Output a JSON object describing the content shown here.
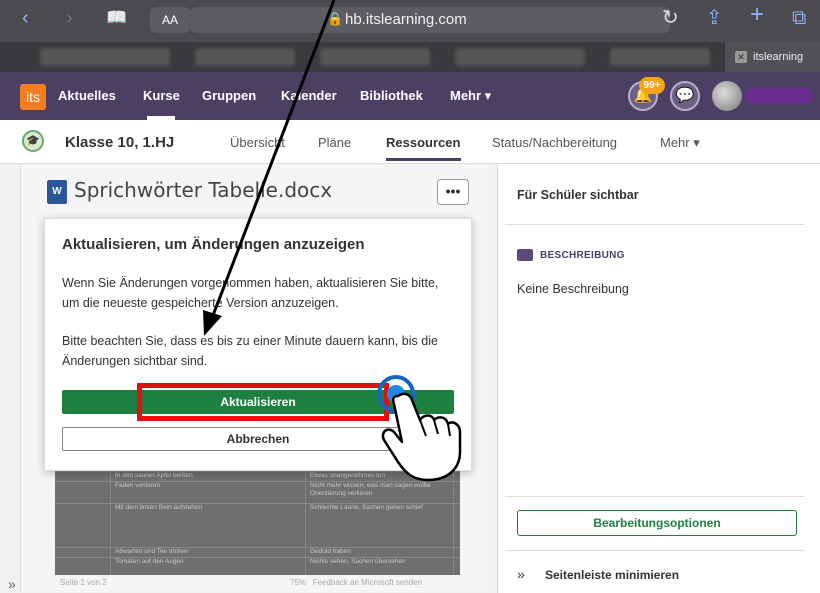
{
  "browser": {
    "aa_label": "AA",
    "url": "hb.itslearning.com",
    "tab_label": "itslearning"
  },
  "appbar": {
    "logo": "its",
    "nav": [
      "Aktuelles",
      "Kurse",
      "Gruppen",
      "Kalender",
      "Bibliothek",
      "Mehr ▾"
    ],
    "notification_badge": "99+"
  },
  "course": {
    "title": "Klasse 10, 1.HJ",
    "tabs": [
      "Übersicht",
      "Pläne",
      "Ressourcen",
      "Status/Nachbereitung",
      "Mehr ▾"
    ],
    "active_tab": "Ressourcen"
  },
  "document": {
    "icon_letter": "W",
    "title": "Sprichwörter Tabelle.docx",
    "more_label": "•••",
    "table_rows": [
      [
        "In den sauren Apfel beißen",
        "Etwas unangenehmes tun"
      ],
      [
        "Faden verlieren",
        "Nicht mehr wissen, was man sagen wollte"
      ],
      [
        "",
        "Orientierung verlieren"
      ],
      [
        "Mit dem linken Bein aufstehen",
        "Schlechte Laune, Sachen gehen schief"
      ],
      [
        "Abwarten und Tee trinken",
        "Geduld haben"
      ],
      [
        "Tomaten auf den Augen",
        "Nichts sehen, Sachen übersehen"
      ]
    ],
    "footer_page": "Seite 1 von 2",
    "footer_zoom": "75%",
    "footer_feedback": "Feedback an Microsoft senden"
  },
  "dialog": {
    "title": "Aktualisieren, um Änderungen anzuzeigen",
    "paragraph1": "Wenn Sie Änderungen vorgenommen haben, aktualisieren Sie bitte, um die neueste gespeicherte Version anzuzeigen.",
    "paragraph2": "Bitte beachten Sie, dass es bis zu einer Minute dauern kann, bis die Änderungen sichtbar sind.",
    "primary_button": "Aktualisieren",
    "secondary_button": "Abbrechen"
  },
  "sidebar": {
    "visibility": "Für Schüler sichtbar",
    "description_heading": "BESCHREIBUNG",
    "description_text": "Keine Beschreibung",
    "edit_button": "Bearbeitungsoptionen",
    "minimize_label": "Seitenleiste minimieren"
  },
  "colors": {
    "appbar": "#4b3f63",
    "primary_green": "#1e8040",
    "highlight_red": "#e01010",
    "annotation": "#000000"
  }
}
